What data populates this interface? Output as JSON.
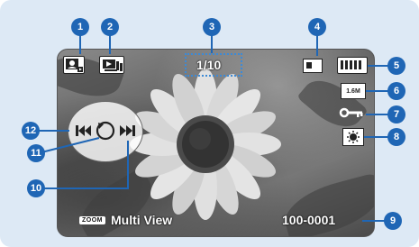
{
  "callouts": [
    "1",
    "2",
    "3",
    "4",
    "5",
    "6",
    "7",
    "8",
    "9",
    "10",
    "11",
    "12"
  ],
  "image_counter": "1/10",
  "file_number": "100-0001",
  "zoom_tag": "ZOOM",
  "zoom_label": "Multi View",
  "resolution_badge": "1.6M",
  "accent_color": "#1f66b5"
}
